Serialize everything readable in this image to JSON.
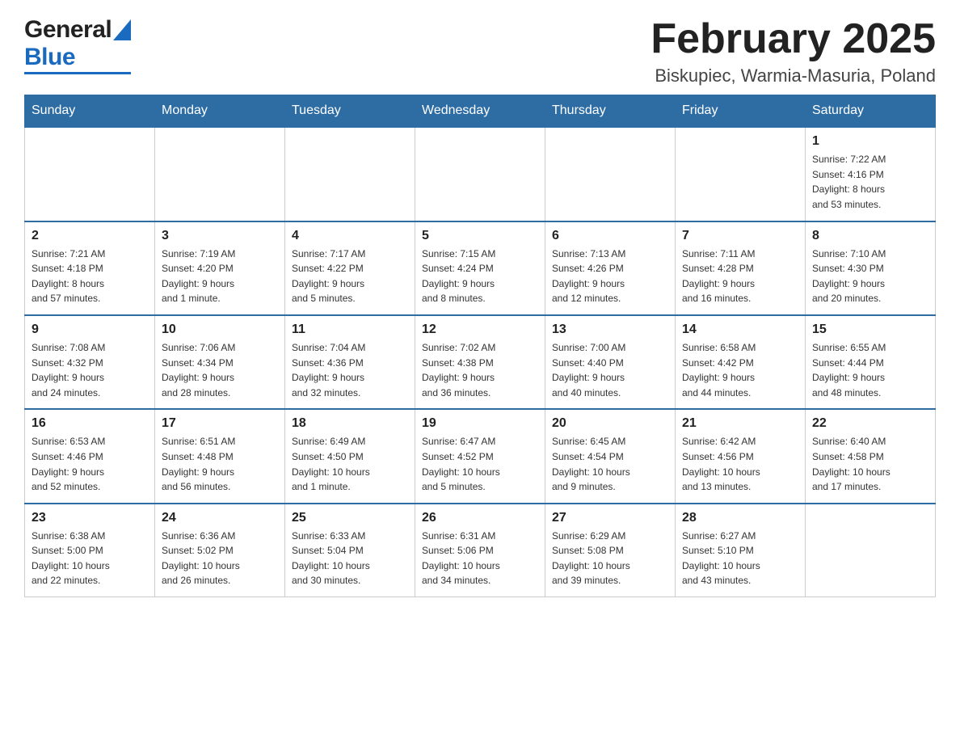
{
  "header": {
    "logo_general": "General",
    "logo_blue": "Blue",
    "month_title": "February 2025",
    "location": "Biskupiec, Warmia-Masuria, Poland"
  },
  "days_of_week": [
    "Sunday",
    "Monday",
    "Tuesday",
    "Wednesday",
    "Thursday",
    "Friday",
    "Saturday"
  ],
  "weeks": [
    [
      {
        "day": "",
        "info": ""
      },
      {
        "day": "",
        "info": ""
      },
      {
        "day": "",
        "info": ""
      },
      {
        "day": "",
        "info": ""
      },
      {
        "day": "",
        "info": ""
      },
      {
        "day": "",
        "info": ""
      },
      {
        "day": "1",
        "info": "Sunrise: 7:22 AM\nSunset: 4:16 PM\nDaylight: 8 hours\nand 53 minutes."
      }
    ],
    [
      {
        "day": "2",
        "info": "Sunrise: 7:21 AM\nSunset: 4:18 PM\nDaylight: 8 hours\nand 57 minutes."
      },
      {
        "day": "3",
        "info": "Sunrise: 7:19 AM\nSunset: 4:20 PM\nDaylight: 9 hours\nand 1 minute."
      },
      {
        "day": "4",
        "info": "Sunrise: 7:17 AM\nSunset: 4:22 PM\nDaylight: 9 hours\nand 5 minutes."
      },
      {
        "day": "5",
        "info": "Sunrise: 7:15 AM\nSunset: 4:24 PM\nDaylight: 9 hours\nand 8 minutes."
      },
      {
        "day": "6",
        "info": "Sunrise: 7:13 AM\nSunset: 4:26 PM\nDaylight: 9 hours\nand 12 minutes."
      },
      {
        "day": "7",
        "info": "Sunrise: 7:11 AM\nSunset: 4:28 PM\nDaylight: 9 hours\nand 16 minutes."
      },
      {
        "day": "8",
        "info": "Sunrise: 7:10 AM\nSunset: 4:30 PM\nDaylight: 9 hours\nand 20 minutes."
      }
    ],
    [
      {
        "day": "9",
        "info": "Sunrise: 7:08 AM\nSunset: 4:32 PM\nDaylight: 9 hours\nand 24 minutes."
      },
      {
        "day": "10",
        "info": "Sunrise: 7:06 AM\nSunset: 4:34 PM\nDaylight: 9 hours\nand 28 minutes."
      },
      {
        "day": "11",
        "info": "Sunrise: 7:04 AM\nSunset: 4:36 PM\nDaylight: 9 hours\nand 32 minutes."
      },
      {
        "day": "12",
        "info": "Sunrise: 7:02 AM\nSunset: 4:38 PM\nDaylight: 9 hours\nand 36 minutes."
      },
      {
        "day": "13",
        "info": "Sunrise: 7:00 AM\nSunset: 4:40 PM\nDaylight: 9 hours\nand 40 minutes."
      },
      {
        "day": "14",
        "info": "Sunrise: 6:58 AM\nSunset: 4:42 PM\nDaylight: 9 hours\nand 44 minutes."
      },
      {
        "day": "15",
        "info": "Sunrise: 6:55 AM\nSunset: 4:44 PM\nDaylight: 9 hours\nand 48 minutes."
      }
    ],
    [
      {
        "day": "16",
        "info": "Sunrise: 6:53 AM\nSunset: 4:46 PM\nDaylight: 9 hours\nand 52 minutes."
      },
      {
        "day": "17",
        "info": "Sunrise: 6:51 AM\nSunset: 4:48 PM\nDaylight: 9 hours\nand 56 minutes."
      },
      {
        "day": "18",
        "info": "Sunrise: 6:49 AM\nSunset: 4:50 PM\nDaylight: 10 hours\nand 1 minute."
      },
      {
        "day": "19",
        "info": "Sunrise: 6:47 AM\nSunset: 4:52 PM\nDaylight: 10 hours\nand 5 minutes."
      },
      {
        "day": "20",
        "info": "Sunrise: 6:45 AM\nSunset: 4:54 PM\nDaylight: 10 hours\nand 9 minutes."
      },
      {
        "day": "21",
        "info": "Sunrise: 6:42 AM\nSunset: 4:56 PM\nDaylight: 10 hours\nand 13 minutes."
      },
      {
        "day": "22",
        "info": "Sunrise: 6:40 AM\nSunset: 4:58 PM\nDaylight: 10 hours\nand 17 minutes."
      }
    ],
    [
      {
        "day": "23",
        "info": "Sunrise: 6:38 AM\nSunset: 5:00 PM\nDaylight: 10 hours\nand 22 minutes."
      },
      {
        "day": "24",
        "info": "Sunrise: 6:36 AM\nSunset: 5:02 PM\nDaylight: 10 hours\nand 26 minutes."
      },
      {
        "day": "25",
        "info": "Sunrise: 6:33 AM\nSunset: 5:04 PM\nDaylight: 10 hours\nand 30 minutes."
      },
      {
        "day": "26",
        "info": "Sunrise: 6:31 AM\nSunset: 5:06 PM\nDaylight: 10 hours\nand 34 minutes."
      },
      {
        "day": "27",
        "info": "Sunrise: 6:29 AM\nSunset: 5:08 PM\nDaylight: 10 hours\nand 39 minutes."
      },
      {
        "day": "28",
        "info": "Sunrise: 6:27 AM\nSunset: 5:10 PM\nDaylight: 10 hours\nand 43 minutes."
      },
      {
        "day": "",
        "info": ""
      }
    ]
  ],
  "colors": {
    "header_bg": "#2e6da4",
    "header_text": "#ffffff",
    "border": "#2e6da4",
    "cell_border": "#ccc"
  }
}
